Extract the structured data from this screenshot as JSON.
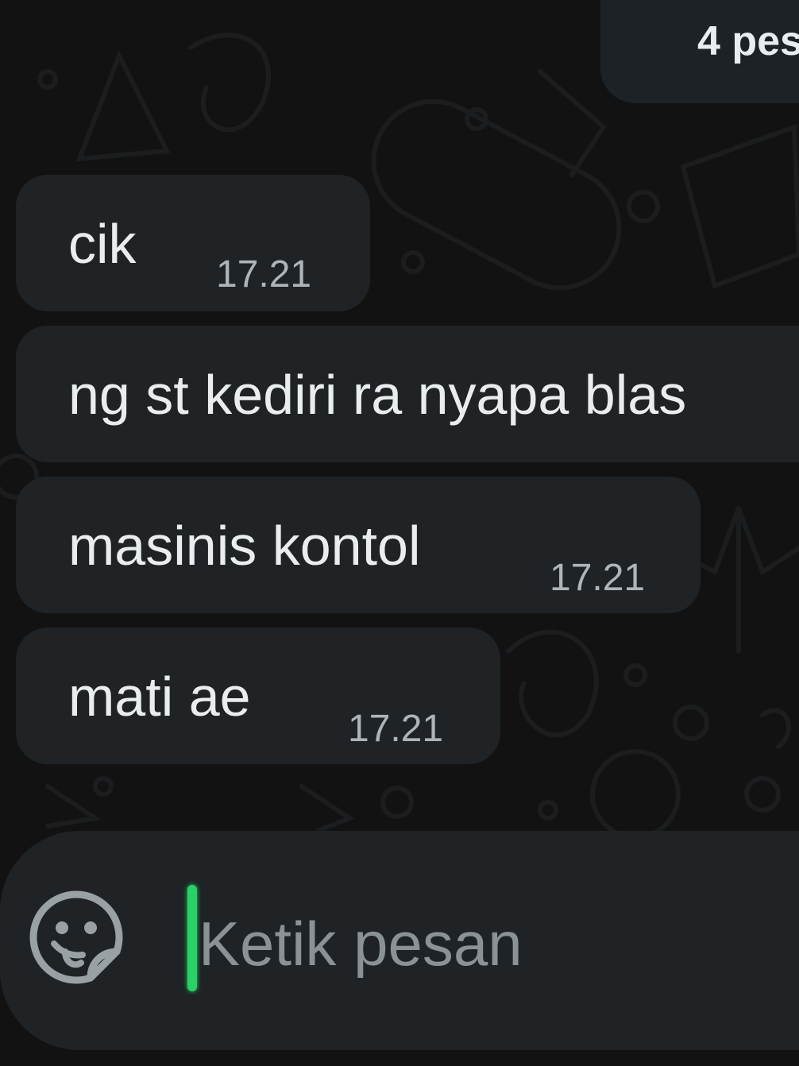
{
  "header": {
    "unread_label": "4 pes"
  },
  "messages": [
    {
      "text": "cik",
      "time": "17.21"
    },
    {
      "text": "ng st kediri ra nyapa blas",
      "time": ""
    },
    {
      "text": "masinis kontol",
      "time": "17.21"
    },
    {
      "text": "mati ae",
      "time": "17.21"
    }
  ],
  "composer": {
    "placeholder": "Ketik pesan",
    "value": "",
    "emoji_icon": "sticker-smiley-icon"
  },
  "colors": {
    "background": "#121212",
    "bubble": "#1f2326",
    "text": "#e9edef",
    "time": "#aeb4b8",
    "caret": "#25d366"
  }
}
